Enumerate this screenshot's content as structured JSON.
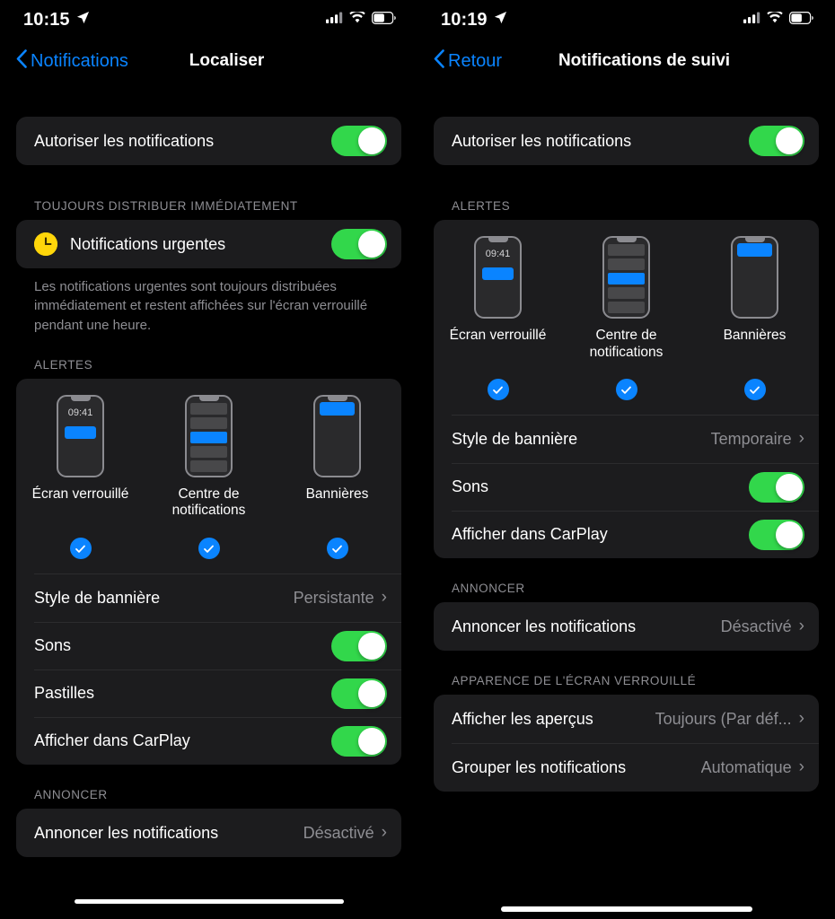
{
  "left_panel": {
    "status_bar": {
      "time": "10:15",
      "location_icon": "location-arrow-icon",
      "cellular_icon": "cellular-signal-icon",
      "wifi_icon": "wifi-icon",
      "battery_icon": "battery-icon"
    },
    "nav": {
      "back_label": "Notifications",
      "back_icon": "chevron-left-icon",
      "title": "Localiser"
    },
    "allow": {
      "label": "Autoriser les notifications",
      "toggle_state": "on"
    },
    "immediate_section": {
      "header": "TOUJOURS DISTRIBUER IMMÉDIATEMENT",
      "row_label": "Notifications urgentes",
      "row_icon": "time-sensitive-clock-icon",
      "toggle_state": "on",
      "footnote": "Les notifications urgentes sont toujours distribuées immédiatement et restent affichées sur l'écran verrouillé pendant une heure."
    },
    "alerts_section": {
      "header": "ALERTES",
      "options": [
        {
          "label": "Écran verrouillé",
          "preview": "lock-screen",
          "preview_time": "09:41",
          "selected": true
        },
        {
          "label": "Centre de notifications",
          "preview": "notification-center",
          "selected": true
        },
        {
          "label": "Bannières",
          "preview": "banners",
          "selected": true
        }
      ],
      "rows": [
        {
          "label": "Style de bannière",
          "value": "Persistante",
          "type": "disclosure"
        },
        {
          "label": "Sons",
          "type": "toggle",
          "toggle_state": "on"
        },
        {
          "label": "Pastilles",
          "type": "toggle",
          "toggle_state": "on"
        },
        {
          "label": "Afficher dans CarPlay",
          "type": "toggle",
          "toggle_state": "on"
        }
      ]
    },
    "announce_section": {
      "header": "ANNONCER",
      "row": {
        "label": "Annoncer les notifications",
        "value": "Désactivé",
        "type": "disclosure"
      }
    }
  },
  "right_panel": {
    "status_bar": {
      "time": "10:19",
      "location_icon": "location-arrow-icon",
      "cellular_icon": "cellular-signal-icon",
      "wifi_icon": "wifi-icon",
      "battery_icon": "battery-icon"
    },
    "nav": {
      "back_label": "Retour",
      "back_icon": "chevron-left-icon",
      "title": "Notifications de suivi"
    },
    "allow": {
      "label": "Autoriser les notifications",
      "toggle_state": "on"
    },
    "alerts_section": {
      "header": "ALERTES",
      "options": [
        {
          "label": "Écran verrouillé",
          "preview": "lock-screen",
          "preview_time": "09:41",
          "selected": true
        },
        {
          "label": "Centre de notifications",
          "preview": "notification-center",
          "selected": true
        },
        {
          "label": "Bannières",
          "preview": "banners",
          "selected": true
        }
      ],
      "rows": [
        {
          "label": "Style de bannière",
          "value": "Temporaire",
          "type": "disclosure"
        },
        {
          "label": "Sons",
          "type": "toggle",
          "toggle_state": "on"
        },
        {
          "label": "Afficher dans CarPlay",
          "type": "toggle",
          "toggle_state": "on"
        }
      ]
    },
    "announce_section": {
      "header": "ANNONCER",
      "row": {
        "label": "Annoncer les notifications",
        "value": "Désactivé",
        "type": "disclosure"
      }
    },
    "lockscreen_section": {
      "header": "APPARENCE DE L'ÉCRAN VERROUILLÉ",
      "rows": [
        {
          "label": "Afficher les aperçus",
          "value": "Toujours (Par déf...",
          "type": "disclosure"
        },
        {
          "label": "Grouper les notifications",
          "value": "Automatique",
          "type": "disclosure"
        }
      ]
    }
  },
  "colors": {
    "accent_blue": "#0a84ff",
    "toggle_green": "#32d74b",
    "card_bg": "#1c1c1e",
    "secondary_text": "#8e8e93",
    "urgent_yellow": "#ffd60a"
  },
  "chevron_glyph": "›"
}
